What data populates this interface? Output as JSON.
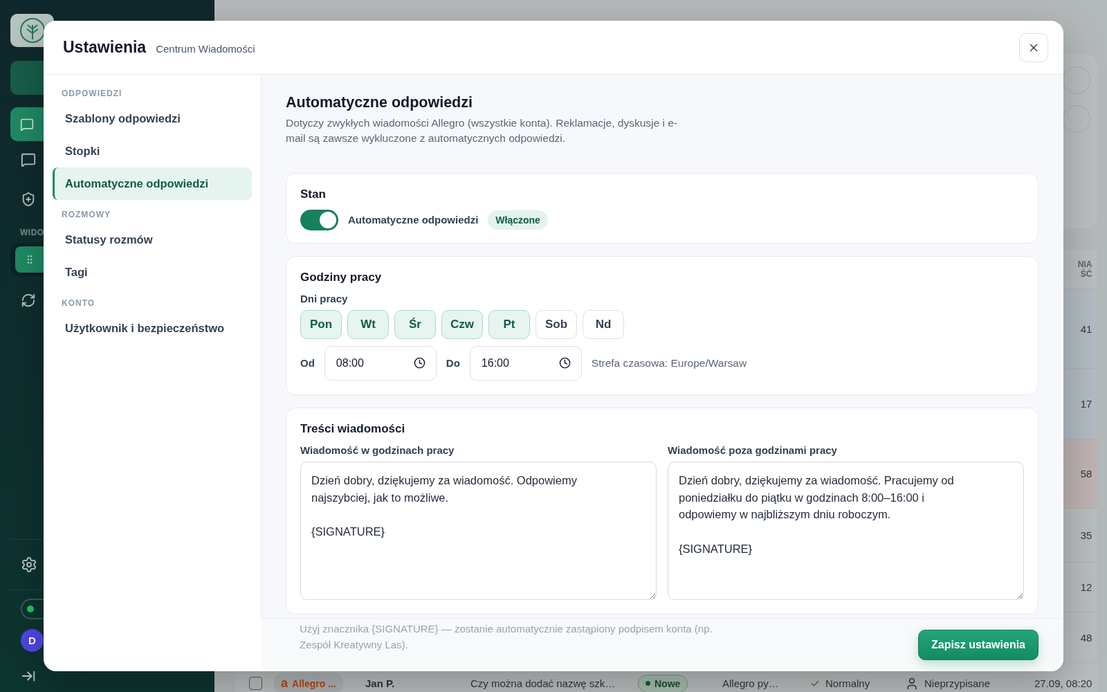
{
  "background": {
    "sidebar": {
      "section_label": "WIDO",
      "avatar": "D"
    },
    "table": {
      "header": "NIA\nŚĆ",
      "values": [
        "41",
        "17",
        "58",
        "35",
        "12",
        "48"
      ],
      "bottom_row": {
        "checked": false,
        "source_mark": "a",
        "source": "Allegro ...",
        "customer": "Jan P.",
        "subject": "Czy można dodać nazwę szk…",
        "status": "Nowe",
        "channel": "Allegro py…",
        "priority": "Normalny",
        "assignee": "Nieprzypisane",
        "date": "27.09, 08:20"
      }
    }
  },
  "dialog": {
    "title": "Ustawienia",
    "subtitle": "Centrum Wiadomości"
  },
  "nav": [
    {
      "heading": "ODPOWIEDZI",
      "items": [
        {
          "label": "Szablony odpowiedzi",
          "selected": false
        },
        {
          "label": "Stopki",
          "selected": false
        },
        {
          "label": "Automatyczne odpowiedzi",
          "selected": true
        }
      ]
    },
    {
      "heading": "ROZMOWY",
      "items": [
        {
          "label": "Statusy rozmów",
          "selected": false
        },
        {
          "label": "Tagi",
          "selected": false
        }
      ]
    },
    {
      "heading": "KONTO",
      "items": [
        {
          "label": "Użytkownik i bezpieczeństwo",
          "selected": false
        }
      ]
    }
  ],
  "page": {
    "title": "Automatyczne odpowiedzi",
    "description": "Dotyczy zwykłych wiadomości Allegro (wszystkie konta). Reklamacje, dyskusje i e-mail są zawsze wykluczone z automatycznych odpowiedzi."
  },
  "status_card": {
    "title": "Stan",
    "toggle_label": "Automatyczne odpowiedzi",
    "on": true,
    "badge": "Włączone"
  },
  "hours_card": {
    "title": "Godziny pracy",
    "days_label": "Dni pracy",
    "days": [
      {
        "label": "Pon",
        "selected": true
      },
      {
        "label": "Wt",
        "selected": true
      },
      {
        "label": "Śr",
        "selected": true
      },
      {
        "label": "Czw",
        "selected": true
      },
      {
        "label": "Pt",
        "selected": true
      },
      {
        "label": "Sob",
        "selected": false
      },
      {
        "label": "Nd",
        "selected": false
      }
    ],
    "from_label": "Od",
    "from": "08:00",
    "to_label": "Do",
    "to": "16:00",
    "timezone": "Strefa czasowa: Europe/Warsaw"
  },
  "messages_card": {
    "title": "Treści wiadomości",
    "fields": [
      {
        "label": "Wiadomość w godzinach pracy",
        "value": "Dzień dobry, dziękujemy za wiadomość. Odpowiemy najszybciej, jak to możliwe.\n\n{SIGNATURE}"
      },
      {
        "label": "Wiadomość poza godzinami pracy",
        "value": "Dzień dobry, dziękujemy za wiadomość. Pracujemy od poniedziałku do piątku w godzinach 8:00–16:00 i odpowiemy w najbliższym dniu roboczym.\n\n{SIGNATURE}"
      }
    ]
  },
  "footer": {
    "hint": "Użyj znacznika {SIGNATURE} — zostanie automatycznie zastąpiony podpisem konta (np. Zespół Kreatywny Las).",
    "save": "Zapisz ustawienia"
  }
}
